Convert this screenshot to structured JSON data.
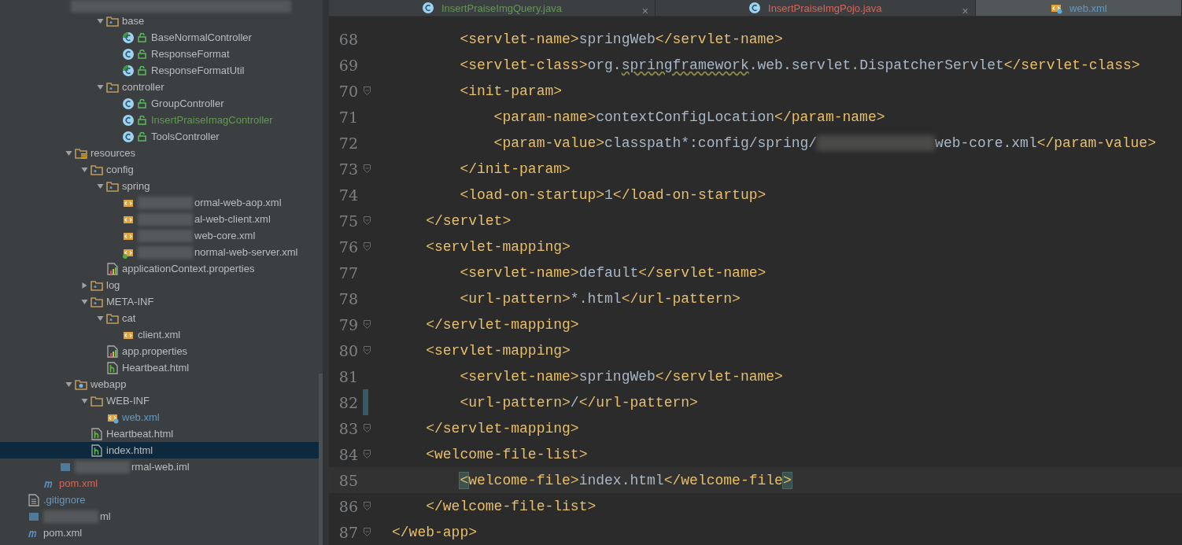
{
  "project_tree": [
    {
      "kind": "group",
      "children": [
        {
          "kind": "group",
          "children": [
            {
              "kind": "group",
              "children": [
                {
                  "kind": "group",
                  "children": [
                    {
                      "kind": "group",
                      "children": [
                        {
                          "kind": "folder",
                          "name": "base",
                          "expanded": true,
                          "selected": false,
                          "children": [
                            {
                              "kind": "class-run",
                              "name": "BaseNormalController",
                              "selected": false
                            },
                            {
                              "kind": "class",
                              "name": "ResponseFormat",
                              "selected": false
                            },
                            {
                              "kind": "class-run",
                              "name": "ResponseFormatUtil",
                              "selected": false
                            }
                          ]
                        },
                        {
                          "kind": "folder",
                          "name": "controller",
                          "expanded": true,
                          "selected": false,
                          "children": [
                            {
                              "kind": "class",
                              "name": "GroupController",
                              "selected": false
                            },
                            {
                              "kind": "class",
                              "name": "InsertPraiseImagController",
                              "color": "#629755",
                              "selected": false
                            },
                            {
                              "kind": "class",
                              "name": "ToolsController",
                              "selected": false
                            }
                          ]
                        }
                      ]
                    }
                  ]
                },
                {
                  "kind": "resource-folder",
                  "name": "resources",
                  "expanded": true,
                  "selected": false,
                  "children": [
                    {
                      "kind": "folder",
                      "name": "config",
                      "expanded": true,
                      "selected": false,
                      "children": [
                        {
                          "kind": "folder",
                          "name": "spring",
                          "expanded": true,
                          "selected": false,
                          "children": [
                            {
                              "kind": "xml",
                              "name": "ormal-web-aop.xml",
                              "blurred": true,
                              "selected": false
                            },
                            {
                              "kind": "xml",
                              "name": "al-web-client.xml",
                              "blurred": true,
                              "selected": false
                            },
                            {
                              "kind": "xml",
                              "name": "web-core.xml",
                              "blurred": true,
                              "selected": false
                            },
                            {
                              "kind": "spring-xml",
                              "name": "normal-web-server.xml",
                              "blurred": true,
                              "selected": false
                            }
                          ]
                        },
                        {
                          "kind": "properties",
                          "name": "applicationContext.properties",
                          "selected": false
                        }
                      ]
                    },
                    {
                      "kind": "folder",
                      "name": "log",
                      "expanded": false,
                      "selected": false
                    },
                    {
                      "kind": "folder",
                      "name": "META-INF",
                      "expanded": true,
                      "selected": false,
                      "children": [
                        {
                          "kind": "folder",
                          "name": "cat",
                          "expanded": true,
                          "selected": false,
                          "children": [
                            {
                              "kind": "xml",
                              "name": "client.xml",
                              "selected": false
                            }
                          ]
                        },
                        {
                          "kind": "properties",
                          "name": "app.properties",
                          "selected": false
                        },
                        {
                          "kind": "html",
                          "name": "Heartbeat.html",
                          "selected": false
                        }
                      ]
                    }
                  ]
                },
                {
                  "kind": "web-folder",
                  "name": "webapp",
                  "expanded": true,
                  "selected": false,
                  "children": [
                    {
                      "kind": "plain-folder",
                      "name": "WEB-INF",
                      "expanded": true,
                      "selected": false,
                      "children": [
                        {
                          "kind": "web-xml",
                          "name": "web.xml",
                          "color": "#6897bb",
                          "selected": false
                        }
                      ]
                    },
                    {
                      "kind": "html",
                      "name": "Heartbeat.html",
                      "selected": false
                    },
                    {
                      "kind": "html",
                      "name": "index.html",
                      "selected": true
                    }
                  ]
                }
              ]
            },
            {
              "kind": "iml",
              "name": "rmal-web.iml",
              "blurred": true,
              "selected": false
            }
          ]
        },
        {
          "kind": "maven",
          "name": "pom.xml",
          "color": "#d1675a",
          "selected": false
        }
      ]
    },
    {
      "kind": "text",
      "name": ".gitignore",
      "color": "#6897bb",
      "selected": false
    },
    {
      "kind": "iml",
      "name": "ml",
      "blurred": true,
      "selected": false
    },
    {
      "kind": "maven",
      "name": "pom.xml",
      "selected": false
    }
  ],
  "editor_tabs": [
    {
      "kind": "class",
      "label": "InsertPraiseImgQuery.java",
      "color": "#629755",
      "selected": false,
      "close": "×"
    },
    {
      "kind": "class",
      "label": "InsertPraiseImgPojo.java",
      "color": "#d1675a",
      "selected": false,
      "close": "×"
    },
    {
      "kind": "web-xml",
      "label": "web.xml",
      "color": "#6897bb",
      "selected": true
    }
  ],
  "code_lines": [
    {
      "number": "68",
      "fold": false,
      "current": false,
      "changed": false,
      "parts": [
        {
          "kind": "tag",
          "text": "        <servlet-name>"
        },
        {
          "kind": "text",
          "text": "springWeb"
        },
        {
          "kind": "tag",
          "text": "</servlet-name>"
        }
      ]
    },
    {
      "number": "69",
      "fold": false,
      "current": false,
      "changed": false,
      "parts": [
        {
          "kind": "tag",
          "text": "        <servlet-class>"
        },
        {
          "kind": "text",
          "text": "org."
        },
        {
          "kind": "typo",
          "text": "springframework"
        },
        {
          "kind": "text",
          "text": ".web.servlet.DispatcherServlet"
        },
        {
          "kind": "tag",
          "text": "</servlet-class>"
        }
      ]
    },
    {
      "number": "70",
      "fold": true,
      "current": false,
      "changed": false,
      "parts": [
        {
          "kind": "tag",
          "text": "        <init-param>"
        }
      ]
    },
    {
      "number": "71",
      "fold": false,
      "current": false,
      "changed": false,
      "parts": [
        {
          "kind": "tag",
          "text": "            <param-name>"
        },
        {
          "kind": "text",
          "text": "contextConfigLocation"
        },
        {
          "kind": "tag",
          "text": "</param-name>"
        }
      ]
    },
    {
      "number": "72",
      "fold": false,
      "current": false,
      "changed": false,
      "parts": [
        {
          "kind": "tag",
          "text": "            <param-value>"
        },
        {
          "kind": "text",
          "text": "classpath*:config/spring/"
        },
        {
          "kind": "blur"
        },
        {
          "kind": "text",
          "text": "web-core.xml"
        },
        {
          "kind": "tag",
          "text": "</param-value>"
        }
      ]
    },
    {
      "number": "73",
      "fold": true,
      "current": false,
      "changed": false,
      "parts": [
        {
          "kind": "tag",
          "text": "        </init-param>"
        }
      ]
    },
    {
      "number": "74",
      "fold": false,
      "current": false,
      "changed": false,
      "parts": [
        {
          "kind": "tag",
          "text": "        <load-on-startup>"
        },
        {
          "kind": "text",
          "text": "1"
        },
        {
          "kind": "tag",
          "text": "</load-on-startup>"
        }
      ]
    },
    {
      "number": "75",
      "fold": true,
      "current": false,
      "changed": false,
      "parts": [
        {
          "kind": "tag",
          "text": "    </servlet>"
        }
      ]
    },
    {
      "number": "76",
      "fold": true,
      "current": false,
      "changed": false,
      "parts": [
        {
          "kind": "tag",
          "text": "    <servlet-mapping>"
        }
      ]
    },
    {
      "number": "77",
      "fold": false,
      "current": false,
      "changed": false,
      "parts": [
        {
          "kind": "tag",
          "text": "        <servlet-name>"
        },
        {
          "kind": "text",
          "text": "default"
        },
        {
          "kind": "tag",
          "text": "</servlet-name>"
        }
      ]
    },
    {
      "number": "78",
      "fold": false,
      "current": false,
      "changed": false,
      "parts": [
        {
          "kind": "tag",
          "text": "        <url-pattern>"
        },
        {
          "kind": "text",
          "text": "*.html"
        },
        {
          "kind": "tag",
          "text": "</url-pattern>"
        }
      ]
    },
    {
      "number": "79",
      "fold": true,
      "current": false,
      "changed": false,
      "parts": [
        {
          "kind": "tag",
          "text": "    </servlet-mapping>"
        }
      ]
    },
    {
      "number": "80",
      "fold": true,
      "current": false,
      "changed": false,
      "parts": [
        {
          "kind": "tag",
          "text": "    <servlet-mapping>"
        }
      ]
    },
    {
      "number": "81",
      "fold": false,
      "current": false,
      "changed": false,
      "parts": [
        {
          "kind": "tag",
          "text": "        <servlet-name>"
        },
        {
          "kind": "text",
          "text": "springWeb"
        },
        {
          "kind": "tag",
          "text": "</servlet-name>"
        }
      ]
    },
    {
      "number": "82",
      "fold": false,
      "current": false,
      "changed": true,
      "parts": [
        {
          "kind": "tag",
          "text": "        <url-pattern>"
        },
        {
          "kind": "text",
          "text": "/"
        },
        {
          "kind": "tag",
          "text": "</url-pattern>"
        }
      ]
    },
    {
      "number": "83",
      "fold": true,
      "current": false,
      "changed": false,
      "parts": [
        {
          "kind": "tag",
          "text": "    </servlet-mapping>"
        }
      ]
    },
    {
      "number": "84",
      "fold": true,
      "current": false,
      "changed": false,
      "parts": [
        {
          "kind": "tag",
          "text": "    <welcome-file-list>"
        }
      ]
    },
    {
      "number": "85",
      "fold": false,
      "current": true,
      "changed": false,
      "parts": [
        {
          "kind": "indent"
        },
        {
          "kind": "match",
          "text": "<"
        },
        {
          "kind": "tag",
          "text": "welcome-file>"
        },
        {
          "kind": "text",
          "text": "index.html"
        },
        {
          "kind": "tag",
          "text": "</welcome-file"
        },
        {
          "kind": "match",
          "text": ">"
        }
      ]
    },
    {
      "number": "86",
      "fold": true,
      "current": false,
      "changed": false,
      "parts": [
        {
          "kind": "tag",
          "text": "    </welcome-file-list>"
        }
      ]
    },
    {
      "number": "87",
      "fold": true,
      "current": false,
      "changed": false,
      "parts": [
        {
          "kind": "tag",
          "text": "</web-app>"
        }
      ]
    }
  ]
}
